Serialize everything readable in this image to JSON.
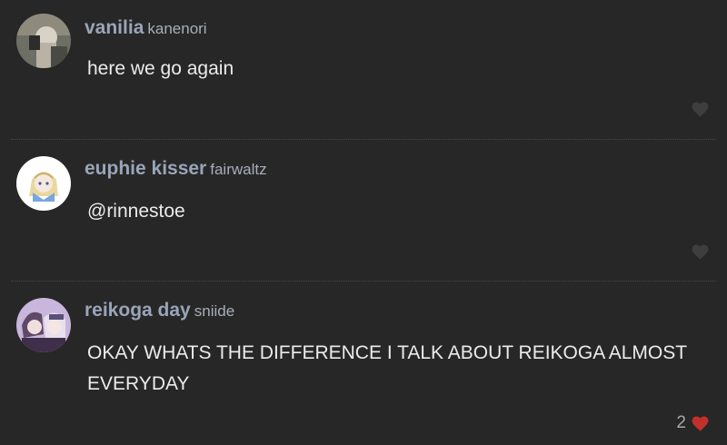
{
  "comments": [
    {
      "display_name": "vanilia",
      "username": "kanenori",
      "text": "here we go again",
      "likes": null,
      "liked": false
    },
    {
      "display_name": "euphie kisser",
      "username": "fairwaltz",
      "text": "@rinnestoe",
      "likes": null,
      "liked": false
    },
    {
      "display_name": "reikoga day",
      "username": "sniide",
      "text": "OKAY WHATS THE DIFFERENCE I TALK ABOUT REIKOGA ALMOST EVERYDAY",
      "likes": "2",
      "liked": true
    }
  ],
  "colors": {
    "background": "#272727",
    "name": "#99a5b8",
    "text": "#ebebeb",
    "heart_inactive": "#3e3e3e",
    "heart_active": "#c2302b"
  },
  "icons": {
    "like": "heart-icon"
  }
}
